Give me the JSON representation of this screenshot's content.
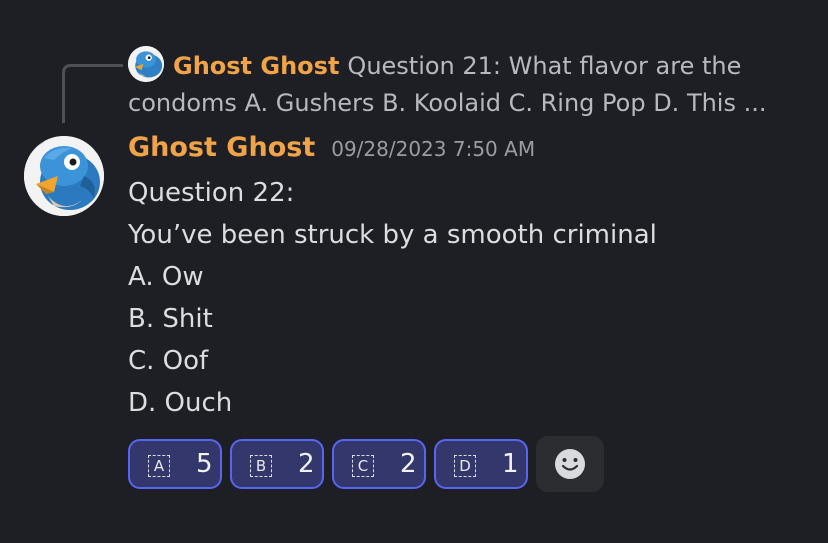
{
  "reply": {
    "author": "Ghost Ghost",
    "preview": "Question 21: What flavor are the condoms  A. Gushers B. Koolaid C. Ring Pop D. This ..."
  },
  "message": {
    "author": "Ghost Ghost",
    "timestamp": "09/28/2023 7:50 AM",
    "lines": [
      "Question 22:",
      "You’ve been struck by a smooth criminal",
      "A. Ow",
      "B. Shit",
      "C. Oof",
      "D. Ouch"
    ]
  },
  "reactions": [
    {
      "emoji_letter": "A",
      "count": "5"
    },
    {
      "emoji_letter": "B",
      "count": "2"
    },
    {
      "emoji_letter": "C",
      "count": "2"
    },
    {
      "emoji_letter": "D",
      "count": "1"
    }
  ],
  "add_reaction_icon": "smiley-face-icon",
  "colors": {
    "background": "#1e1f24",
    "author_name": "#f0a347",
    "reaction_border": "#5865f2",
    "reaction_bg": "#33376b"
  }
}
